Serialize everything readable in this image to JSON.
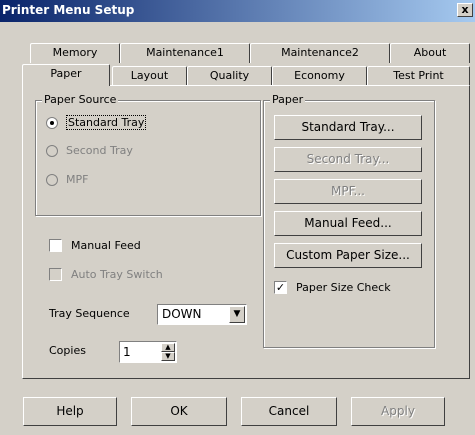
{
  "window": {
    "title": "Printer Menu Setup",
    "close_glyph": "x"
  },
  "tabs": {
    "row_back": [
      "Memory",
      "Maintenance1",
      "Maintenance2",
      "About"
    ],
    "row_front": [
      "Paper",
      "Layout",
      "Quality",
      "Economy",
      "Test Print"
    ],
    "selected": "Paper"
  },
  "paper_source": {
    "legend": "Paper Source",
    "options": [
      {
        "label": "Standard Tray",
        "selected": true,
        "enabled": true
      },
      {
        "label": "Second Tray",
        "selected": false,
        "enabled": false
      },
      {
        "label": "MPF",
        "selected": false,
        "enabled": false
      }
    ]
  },
  "manual_feed_label": "Manual Feed",
  "auto_tray_switch_label": "Auto Tray Switch",
  "tray_sequence": {
    "label": "Tray Sequence",
    "value": "DOWN"
  },
  "copies": {
    "label": "Copies",
    "value": "1"
  },
  "paper_group": {
    "legend": "Paper",
    "buttons": [
      "Standard Tray...",
      "Second Tray...",
      "MPF...",
      "Manual Feed...",
      "Custom Paper Size..."
    ],
    "size_check_label": "Paper Size Check",
    "size_check_checked": true
  },
  "footer": {
    "help": "Help",
    "ok": "OK",
    "cancel": "Cancel",
    "apply": "Apply"
  }
}
